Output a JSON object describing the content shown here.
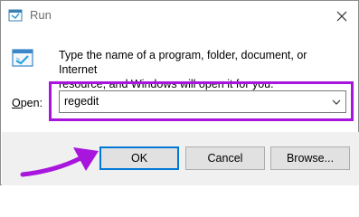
{
  "window": {
    "title": "Run",
    "close_icon": "close-icon"
  },
  "dialog": {
    "description_line1": "Type the name of a program, folder, document, or Internet",
    "description_line2": "resource, and Windows will open it for you.",
    "open_label_accel": "O",
    "open_label_rest": "pen:",
    "open_value": "regedit"
  },
  "buttons": {
    "ok": "OK",
    "cancel": "Cancel",
    "browse": "Browse..."
  },
  "colors": {
    "highlight": "#a815dc",
    "arrow": "#a815dc",
    "ok_focus": "#0078d7"
  }
}
